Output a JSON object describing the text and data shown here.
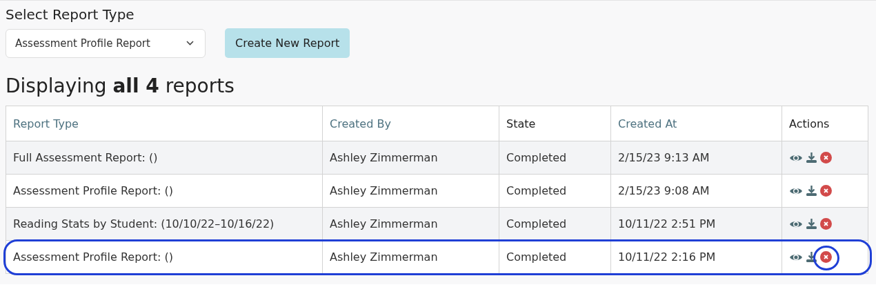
{
  "report_select": {
    "label": "Select Report Type",
    "value": "Assessment Profile Report"
  },
  "create_button": "Create New Report",
  "heading": "Displaying **all 4** reports",
  "table": {
    "columns": [
      {
        "label": "Report Type",
        "sortable": true
      },
      {
        "label": "Created By",
        "sortable": true
      },
      {
        "label": "State",
        "sortable": false
      },
      {
        "label": "Created At",
        "sortable": true
      },
      {
        "label": "Actions",
        "sortable": false
      }
    ],
    "rows": [
      {
        "cells": [
          "Full Assessment Report: ()",
          "Ashley Zimmerman",
          "Completed",
          "2/15/23 9:13 AM"
        ],
        "highlighted": false
      },
      {
        "cells": [
          "Assessment Profile Report: ()",
          "Ashley Zimmerman",
          "Completed",
          "2/15/23 9:08 AM"
        ],
        "highlighted": false
      },
      {
        "cells": [
          "Reading Stats by Student: (10/10/22–10/16/22)",
          "Ashley Zimmerman",
          "Completed",
          "10/11/22 2:51 PM"
        ],
        "highlighted": false
      },
      {
        "cells": [
          "Assessment Profile Report: ()",
          "Ashley Zimmerman",
          "Completed",
          "10/11/22 2:16 PM"
        ],
        "highlighted": true
      }
    ]
  }
}
